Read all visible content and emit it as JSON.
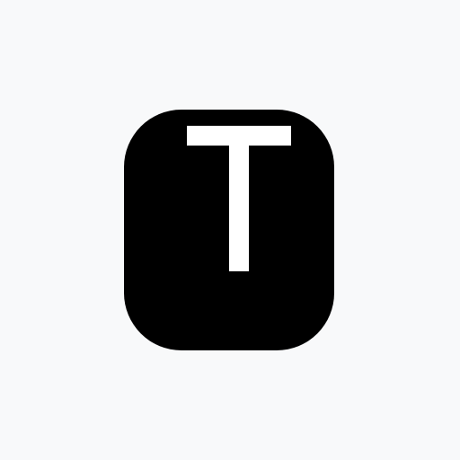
{
  "icon": {
    "name": "t-logo-icon",
    "glyph": "T",
    "background_color": "#f8f9fa",
    "tile_color": "#000000",
    "glyph_color": "#ffffff"
  }
}
